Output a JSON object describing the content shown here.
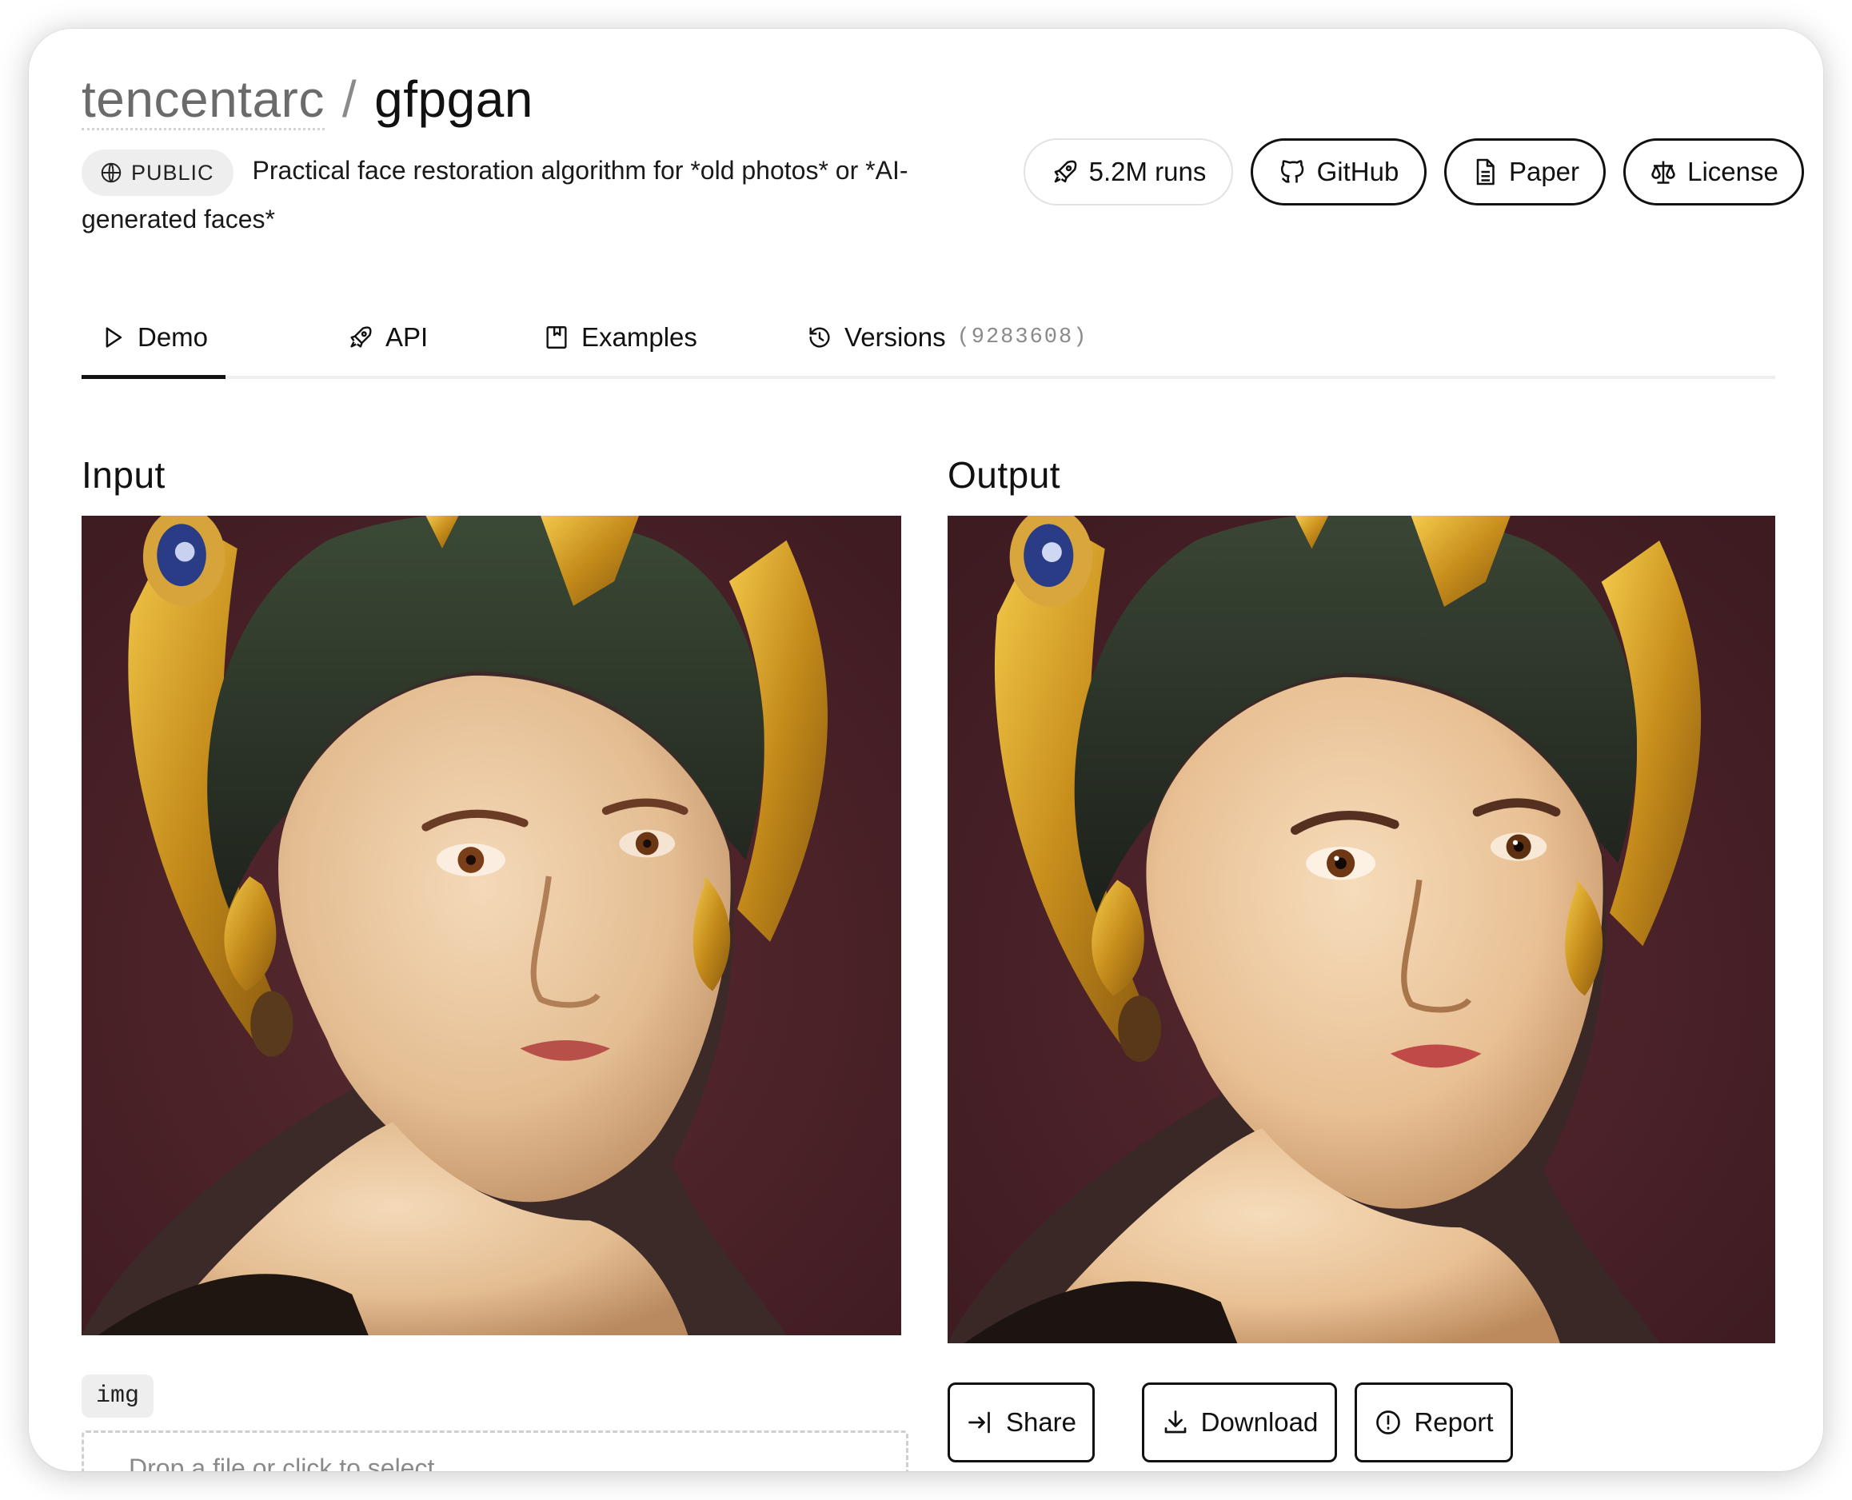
{
  "header": {
    "owner": "tencentarc",
    "separator": "/",
    "repo": "gfpgan"
  },
  "description": {
    "visibility": "PUBLIC",
    "text": "Practical face restoration algorithm for *old photos* or *AI-generated faces*"
  },
  "actions": {
    "runs": "5.2M runs",
    "github": "GitHub",
    "paper": "Paper",
    "license": "License"
  },
  "tabs": [
    {
      "label": "Demo",
      "active": true
    },
    {
      "label": "API"
    },
    {
      "label": "Examples"
    },
    {
      "label": "Versions",
      "meta": "(9283608)"
    }
  ],
  "input": {
    "heading": "Input",
    "image_alt": "Painted portrait of a young woman wearing a dark patterned turban with golden crescent headdress and earrings, maroon background",
    "field_label": "img",
    "dropzone_text": "Drop a file or click to select"
  },
  "output": {
    "heading": "Output",
    "image_alt": "Restored version of the same portrait with sharper facial details",
    "buttons": {
      "share": "Share",
      "download": "Download",
      "report": "Report"
    }
  },
  "colors": {
    "background": "#4a2127",
    "gold": "#d4a126",
    "skin": "#eac39a",
    "turban": "#2f3a2a",
    "text": "#111111",
    "muted": "#8a8a8a"
  }
}
